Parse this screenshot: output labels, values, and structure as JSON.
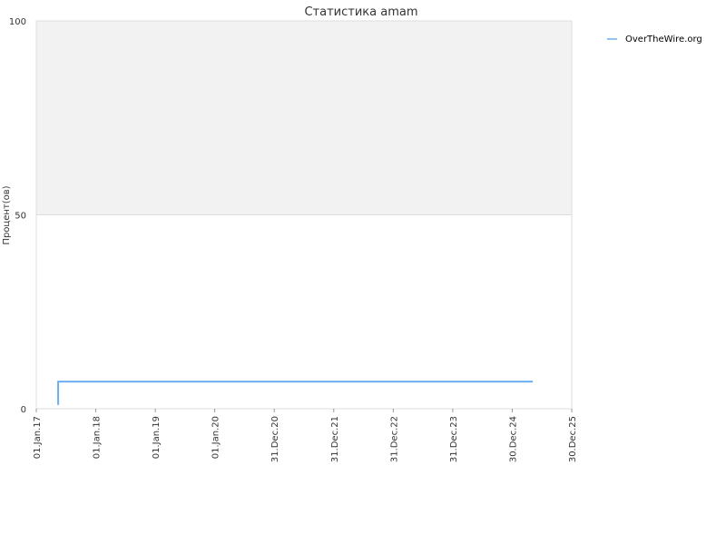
{
  "chart_data": {
    "type": "line",
    "title": "Статистика amam",
    "xlabel": "",
    "ylabel": "Процент(ов)",
    "x_tick_labels": [
      "01.Jan.17",
      "01.Jan.18",
      "01.Jan.19",
      "01.Jan.20",
      "31.Dec.20",
      "31.Dec.21",
      "31.Dec.22",
      "31.Dec.23",
      "30.Dec.24",
      "30.Dec.25"
    ],
    "y_tick_labels": [
      "0",
      "50",
      "100"
    ],
    "ylim": [
      0,
      100
    ],
    "xlim": [
      "2017-01-01",
      "2025-12-30"
    ],
    "grid": true,
    "shaded_band": [
      50,
      100
    ],
    "legend_position": "top-right",
    "series": [
      {
        "name": "OverTheWire.org",
        "color": "#6aaef0",
        "points": [
          {
            "x": "2017-05-15",
            "y": 1
          },
          {
            "x": "2017-05-15",
            "y": 7
          },
          {
            "x": "2025-05-05",
            "y": 7
          }
        ]
      }
    ]
  }
}
